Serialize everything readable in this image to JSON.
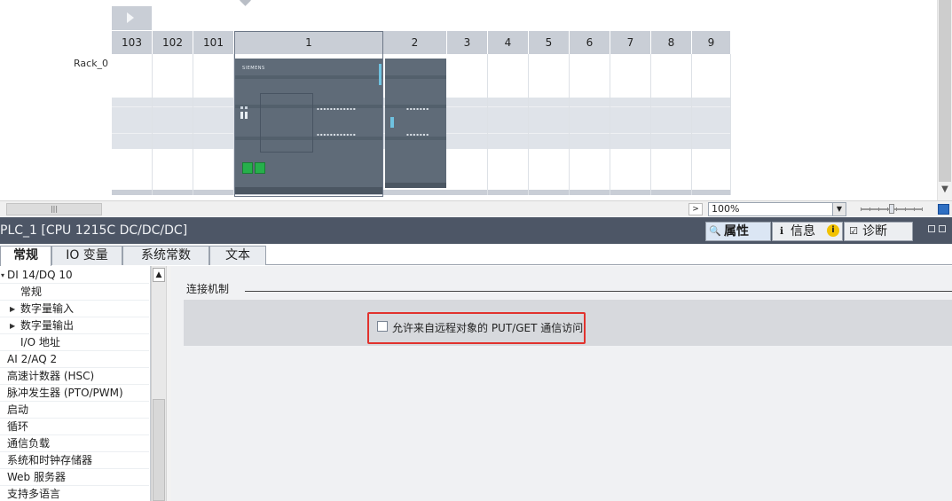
{
  "device_view": {
    "rack_label": "Rack_0",
    "slots": [
      "103",
      "102",
      "101",
      "1",
      "2",
      "3",
      "4",
      "5",
      "6",
      "7",
      "8",
      "9"
    ],
    "cpu_brand": "SIEMENS",
    "scroll_thumb_glyph": "|||"
  },
  "toolbar": {
    "zoom_value": "100%"
  },
  "inspector": {
    "title": "PLC_1 [CPU 1215C DC/DC/DC]",
    "tabs": [
      {
        "label": "属性",
        "icon": "properties-icon"
      },
      {
        "label": "信息",
        "icon": "info-icon"
      },
      {
        "label": "诊断",
        "icon": "diagnostics-icon"
      }
    ],
    "info_badge": "i"
  },
  "property_tabs": [
    "常规",
    "IO 变量",
    "系统常数",
    "文本"
  ],
  "nav_tree": {
    "items": [
      {
        "label": "DI 14/DQ 10",
        "indent": 0,
        "arrow": "▾"
      },
      {
        "label": "常规",
        "indent": 2,
        "arrow": ""
      },
      {
        "label": "数字量输入",
        "indent": 1,
        "arrow": "▶"
      },
      {
        "label": "数字量输出",
        "indent": 1,
        "arrow": "▶"
      },
      {
        "label": "I/O 地址",
        "indent": 2,
        "arrow": ""
      },
      {
        "label": "AI 2/AQ 2",
        "indent": 0,
        "arrow": ""
      },
      {
        "label": "高速计数器 (HSC)",
        "indent": 0,
        "arrow": ""
      },
      {
        "label": "脉冲发生器 (PTO/PWM)",
        "indent": 0,
        "arrow": ""
      },
      {
        "label": "启动",
        "indent": 0,
        "arrow": ""
      },
      {
        "label": "循环",
        "indent": 0,
        "arrow": ""
      },
      {
        "label": "通信负载",
        "indent": 0,
        "arrow": ""
      },
      {
        "label": "系统和时钟存储器",
        "indent": 0,
        "arrow": ""
      },
      {
        "label": "Web 服务器",
        "indent": 0,
        "arrow": ""
      },
      {
        "label": "支持多语言",
        "indent": 0,
        "arrow": ""
      }
    ]
  },
  "content": {
    "section_title": "连接机制",
    "put_get_label": "允许来自远程对象的 PUT/GET 通信访问",
    "put_get_checked": false
  },
  "colors": {
    "inspector_bar": "#4d5666",
    "highlight": "#e1322d",
    "module": "#5f6b78",
    "port": "#26b04b"
  }
}
